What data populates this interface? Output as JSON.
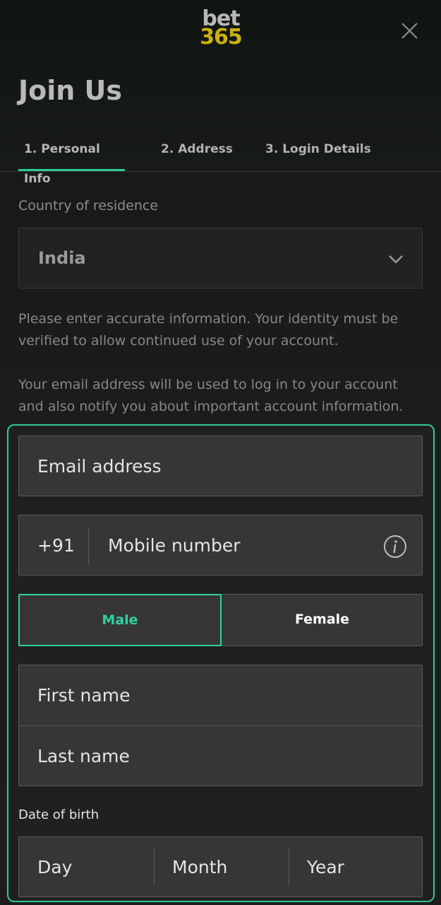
{
  "header": {
    "logo_top": "bet",
    "logo_bottom": "365",
    "title": "Join Us",
    "close_icon": "close-icon"
  },
  "tabs": [
    {
      "label": "1.  Personal Info",
      "active": true
    },
    {
      "label": "2.  Address",
      "active": false
    },
    {
      "label": "3.  Login Details",
      "active": false
    }
  ],
  "country": {
    "label": "Country of residence",
    "value": "India",
    "icon": "chevron-down-icon"
  },
  "info": {
    "identity_text": "Please enter accurate information. Your identity must be verified to allow continued use of your account.",
    "email_text": "Your email address will be used to log in to your account and also notify you about important account information."
  },
  "form": {
    "email_placeholder": "Email address",
    "mobile_prefix": "+91",
    "mobile_placeholder": "Mobile number",
    "mobile_info_icon": "info-icon",
    "gender": {
      "male": "Male",
      "female": "Female",
      "selected": "Male"
    },
    "first_name_placeholder": "First name",
    "last_name_placeholder": "Last name",
    "dob": {
      "label": "Date of birth",
      "day": "Day",
      "month": "Month",
      "year": "Year"
    }
  },
  "colors": {
    "accent": "#2fd0a0",
    "logo_yellow": "#c9b20b",
    "background": "#1b1b1b",
    "field_bg": "#363636"
  }
}
